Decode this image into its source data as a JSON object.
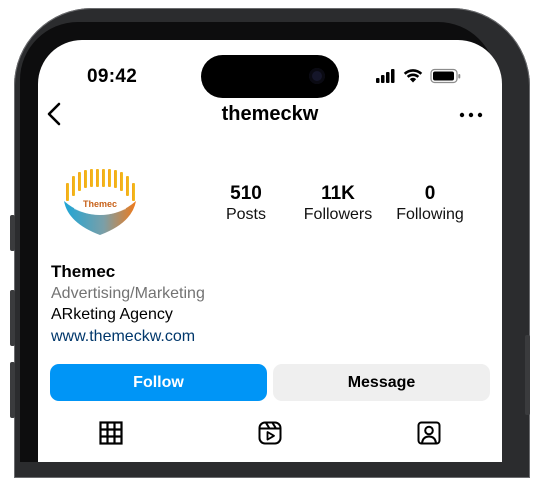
{
  "status_bar": {
    "time": "09:42",
    "icons": [
      "signal-icon",
      "wifi-icon",
      "battery-icon"
    ]
  },
  "header": {
    "title": "themeckw",
    "back_icon": "chevron-left-icon",
    "more_icon": "more-horizontal-icon"
  },
  "profile": {
    "avatar_text": "Themec",
    "stats": [
      {
        "value": "510",
        "label": "Posts"
      },
      {
        "value": "11K",
        "label": "Followers"
      },
      {
        "value": "0",
        "label": "Following"
      }
    ],
    "name": "Themec",
    "category": "Advertising/Marketing",
    "bio": "ARketing Agency",
    "website": "www.themeckw.com"
  },
  "actions": {
    "follow_label": "Follow",
    "message_label": "Message"
  },
  "tabs": [
    {
      "icon": "grid-icon",
      "active": true
    },
    {
      "icon": "reels-icon",
      "active": false
    },
    {
      "icon": "tagged-icon",
      "active": false
    }
  ],
  "colors": {
    "follow_button": "#0095f6",
    "message_button": "#efefef",
    "link": "#00376b",
    "category_text": "#737373"
  }
}
